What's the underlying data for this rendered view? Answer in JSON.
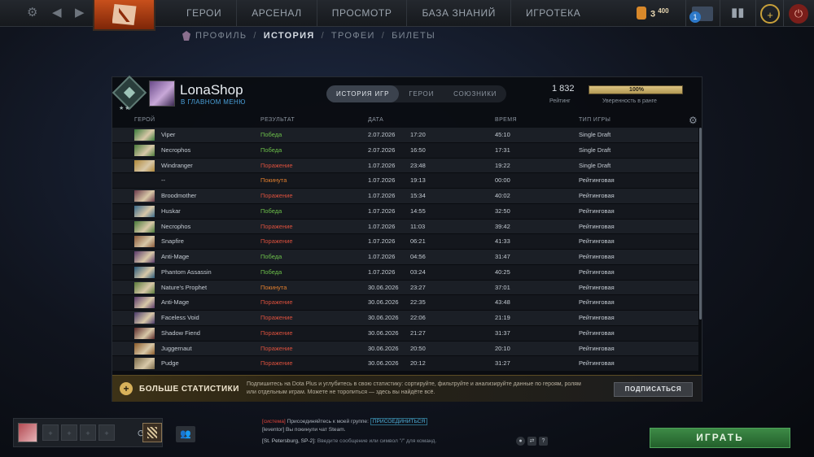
{
  "topbar": {
    "nav": [
      "ГЕРОИ",
      "АРСЕНАЛ",
      "ПРОСМОТР",
      "БАЗА ЗНАНИЙ",
      "ИГРОТЕКА"
    ],
    "shards": "3",
    "shards_sup": "400",
    "notification_count": "1"
  },
  "subnav": {
    "profile": "ПРОФИЛЬ",
    "history": "ИСТОРИЯ",
    "trophies": "ТРОФЕИ",
    "tickets": "БИЛЕТЫ"
  },
  "profile": {
    "username": "LonaShop",
    "status": "В ГЛАВНОМ МЕНЮ",
    "tabs": [
      "ИСТОРИЯ ИГР",
      "ГЕРОИ",
      "СОЮЗНИКИ"
    ],
    "rating": "1 832",
    "rating_label": "Рейтинг",
    "confidence": "100%",
    "confidence_value": 1.0,
    "confidence_label": "Уверенность в ранге"
  },
  "table": {
    "headers": [
      "ГЕРОЙ",
      "РЕЗУЛЬТАТ",
      "ДАТА",
      "ВРЕМЯ",
      "ТИП ИГРЫ"
    ],
    "rows": [
      {
        "hero": "Viper",
        "result": "Победа",
        "kind": "win",
        "date": "2.07.2026",
        "time": "17:20",
        "duration": "45:10",
        "type": "Single Draft",
        "color": "#3a7a3a"
      },
      {
        "hero": "Necrophos",
        "result": "Победа",
        "kind": "win",
        "date": "2.07.2026",
        "time": "16:50",
        "duration": "17:31",
        "type": "Single Draft",
        "color": "#4a7a3a"
      },
      {
        "hero": "Windranger",
        "result": "Поражение",
        "kind": "loss",
        "date": "1.07.2026",
        "time": "23:48",
        "duration": "19:22",
        "type": "Single Draft",
        "color": "#b0883a"
      },
      {
        "hero": "--",
        "result": "Покинута",
        "kind": "abandon",
        "date": "1.07.2026",
        "time": "19:13",
        "duration": "00:00",
        "type": "Рейтинговая",
        "color": ""
      },
      {
        "hero": "Broodmother",
        "result": "Поражение",
        "kind": "loss",
        "date": "1.07.2026",
        "time": "15:34",
        "duration": "40:02",
        "type": "Рейтинговая",
        "color": "#6a3a4a"
      },
      {
        "hero": "Huskar",
        "result": "Победа",
        "kind": "win",
        "date": "1.07.2026",
        "time": "14:55",
        "duration": "32:50",
        "type": "Рейтинговая",
        "color": "#3a6a8a"
      },
      {
        "hero": "Necrophos",
        "result": "Поражение",
        "kind": "loss",
        "date": "1.07.2026",
        "time": "11:03",
        "duration": "39:42",
        "type": "Рейтинговая",
        "color": "#4a7a3a"
      },
      {
        "hero": "Snapfire",
        "result": "Поражение",
        "kind": "loss",
        "date": "1.07.2026",
        "time": "06:21",
        "duration": "41:33",
        "type": "Рейтинговая",
        "color": "#8a5a3a"
      },
      {
        "hero": "Anti-Mage",
        "result": "Победа",
        "kind": "win",
        "date": "1.07.2026",
        "time": "04:56",
        "duration": "31:47",
        "type": "Рейтинговая",
        "color": "#5a3a6a"
      },
      {
        "hero": "Phantom Assassin",
        "result": "Победа",
        "kind": "win",
        "date": "1.07.2026",
        "time": "03:24",
        "duration": "40:25",
        "type": "Рейтинговая",
        "color": "#2a5a7a"
      },
      {
        "hero": "Nature's Prophet",
        "result": "Покинута",
        "kind": "abandon",
        "date": "30.06.2026",
        "time": "23:27",
        "duration": "37:01",
        "type": "Рейтинговая",
        "color": "#5a7a3a"
      },
      {
        "hero": "Anti-Mage",
        "result": "Поражение",
        "kind": "loss",
        "date": "30.06.2026",
        "time": "22:35",
        "duration": "43:48",
        "type": "Рейтинговая",
        "color": "#5a3a6a"
      },
      {
        "hero": "Faceless Void",
        "result": "Поражение",
        "kind": "loss",
        "date": "30.06.2026",
        "time": "22:06",
        "duration": "21:19",
        "type": "Рейтинговая",
        "color": "#4a3a6a"
      },
      {
        "hero": "Shadow Fiend",
        "result": "Поражение",
        "kind": "loss",
        "date": "30.06.2026",
        "time": "21:27",
        "duration": "31:37",
        "type": "Рейтинговая",
        "color": "#5a2a2a"
      },
      {
        "hero": "Juggernaut",
        "result": "Поражение",
        "kind": "loss",
        "date": "30.06.2026",
        "time": "20:50",
        "duration": "20:10",
        "type": "Рейтинговая",
        "color": "#8a5a2a"
      },
      {
        "hero": "Pudge",
        "result": "Поражение",
        "kind": "loss",
        "date": "30.06.2026",
        "time": "20:12",
        "duration": "31:27",
        "type": "Рейтинговая",
        "color": "#7a6a4a"
      }
    ]
  },
  "promo": {
    "title": "БОЛЬШЕ СТАТИСТИКИ",
    "text": "Подпишитесь на Dota Plus и углубитесь в свою статистику: сортируйте, фильтруйте и анализируйте данные по героям, ролям или отдельным играм. Можете не торопиться — здесь вы найдёте всё.",
    "button": "ПОДПИСАТЬСЯ"
  },
  "chat": {
    "line1_prefix": "[система]",
    "line1_text": "Присоединяйтесь к моей группе:",
    "line1_join": "ПРИСОЕДИНИТЬСЯ",
    "line2": "[leventor] Вы покинули чат Steam.",
    "input_channel": "[St. Petersburg, SP-2]:",
    "input_placeholder": "Введите сообщение или символ \"/\" для команд."
  },
  "play_button": "ИГРАТЬ"
}
